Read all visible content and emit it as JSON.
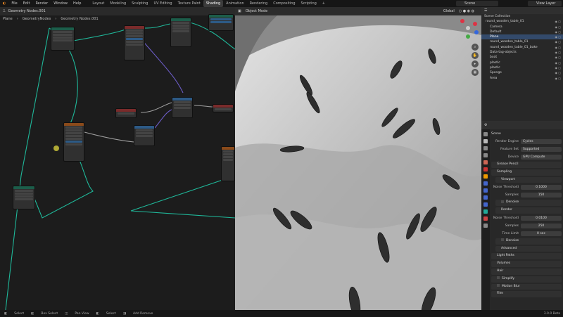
{
  "menu": [
    "File",
    "Edit",
    "Render",
    "Window",
    "Help"
  ],
  "workspaces": [
    "Layout",
    "Modeling",
    "Sculpting",
    "UV Editing",
    "Texture Paint",
    "Shading",
    "Animation",
    "Rendering",
    "Compositing",
    "Scripting"
  ],
  "active_workspace": "Shading",
  "scene": "Scene",
  "view_layer": "View Layer",
  "node_editor": {
    "tree_name": "Geometry Nodes.001",
    "breadcrumb": [
      "Plane",
      "GeometryNodes",
      "Geometry Nodes.001"
    ]
  },
  "viewport": {
    "mode": "Object Mode",
    "orientation": "Global"
  },
  "outliner": {
    "title": "Scene Collection",
    "items": [
      {
        "label": "round_wooden_table_01",
        "indent": 0,
        "selected": false
      },
      {
        "label": "Camera",
        "indent": 1,
        "selected": false
      },
      {
        "label": "Default",
        "indent": 1,
        "selected": false
      },
      {
        "label": "Plane",
        "indent": 1,
        "selected": true
      },
      {
        "label": "round_wooden_table_01",
        "indent": 1,
        "selected": false
      },
      {
        "label": "round_wooden_table_01_bake",
        "indent": 1,
        "selected": false
      },
      {
        "label": "Data-tag-objects",
        "indent": 1,
        "selected": false
      },
      {
        "label": "boat",
        "indent": 1,
        "selected": false
      },
      {
        "label": "plastic",
        "indent": 1,
        "selected": false
      },
      {
        "label": "plastic",
        "indent": 1,
        "selected": false
      },
      {
        "label": "Sponge",
        "indent": 1,
        "selected": false
      },
      {
        "label": "Area",
        "indent": 1,
        "selected": false
      }
    ]
  },
  "properties": {
    "scene_label": "Scene",
    "render_engine_label": "Render Engine",
    "render_engine": "Cycles",
    "feature_set_label": "Feature Set",
    "feature_set": "Supported",
    "device_label": "Device",
    "device": "GPU Compute",
    "grease_pencil": "Grease Pencil",
    "sampling": "Sampling",
    "viewport": "Viewport",
    "noise_threshold_label": "Noise Threshold",
    "vp_noise_threshold": "0.1000",
    "samples_label": "Samples",
    "vp_samples": "150",
    "denoise": "Denoise",
    "render": "Render",
    "r_noise_threshold": "0.0100",
    "r_samples": "250",
    "time_limit_label": "Time Limit",
    "time_limit": "0 sec",
    "denoise2": "Denoise",
    "advanced": "Advanced",
    "light_paths": "Light Paths",
    "volumes": "Volumes",
    "hair": "Hair",
    "simplify": "Simplify",
    "motion_blur": "Motion Blur",
    "film": "Film"
  },
  "status": {
    "select": "Select",
    "box_select": "Box Select",
    "pan_view": "Pan View",
    "select2": "Select",
    "add_remove": "Add Remove",
    "version": "3.0.0 Beta"
  },
  "colors": {
    "wire_geometry": "#1fb89a",
    "wire_float": "#a0a0a0",
    "wire_vector": "#6c5dc8",
    "node_header_green": "#1c5d4a",
    "node_header_blue": "#2d5a86",
    "node_header_red": "#7a2b2b",
    "node_header_orange": "#8a4a1a",
    "selection": "#334a6b"
  }
}
